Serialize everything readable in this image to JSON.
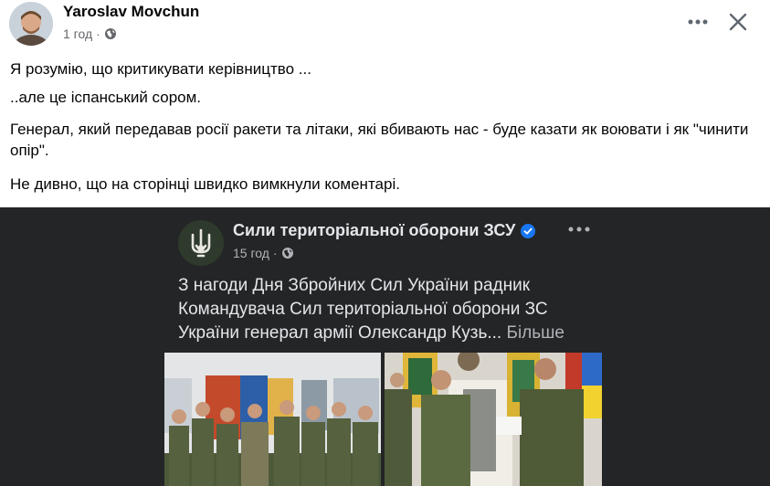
{
  "post": {
    "author": "Yaroslav Movchun",
    "time": "1 год",
    "separator": "·",
    "paragraphs": [
      "Я розумію,  що критикувати керівництво ...",
      "..але це іспанський сором.",
      "Генерал, який передавав росії ракети та літаки, які вбивають нас - буде казати як воювати і як \"чинити опір\".",
      "Не дивно,  що на сторінці швидко вимкнули коментарі."
    ]
  },
  "shared": {
    "page_name": "Сили територіальної оборони ЗСУ",
    "time": "15 год",
    "separator": "·",
    "text": "З нагоди Дня Збройних Сил України радник Командувача Сил територіальної оборони ЗС України генерал армії Олександр Кузь...",
    "see_more": "Більше"
  },
  "colors": {
    "text_primary": "#050505",
    "text_secondary": "#65676b",
    "shared_bg": "#242526",
    "shared_text": "#e4e6eb",
    "verified": "#1877f2"
  },
  "icons": {
    "globe": "globe-icon",
    "more": "more-horizontal-icon",
    "close": "close-icon",
    "verified": "verified-badge-icon"
  }
}
